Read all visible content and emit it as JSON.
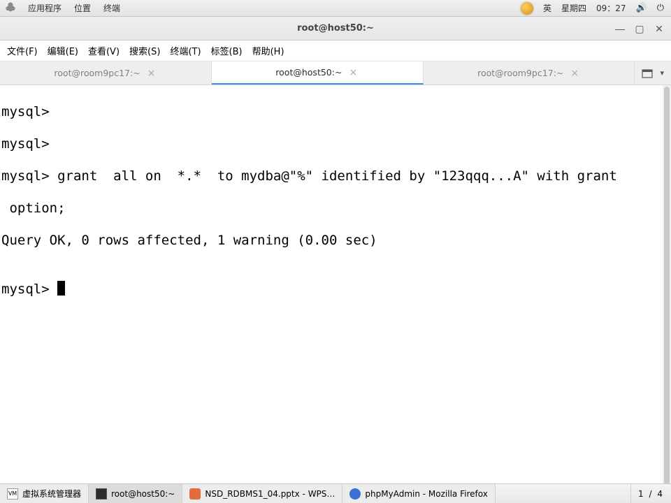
{
  "top_panel": {
    "apps": "应用程序",
    "places": "位置",
    "terminal": "终端",
    "ime_lang": "英",
    "day": "星期四",
    "time": "09：27"
  },
  "window": {
    "title": "root@host50:~",
    "btn_min": "—",
    "btn_max": "▢",
    "btn_close": "✕"
  },
  "menubar": {
    "file": "文件(F)",
    "edit": "编辑(E)",
    "view": "查看(V)",
    "search": "搜索(S)",
    "terminal": "终端(T)",
    "tabs": "标签(B)",
    "help": "帮助(H)"
  },
  "tabs": {
    "t0": {
      "label": "root@room9pc17:~",
      "close": "×"
    },
    "t1": {
      "label": "root@host50:~",
      "close": "×"
    },
    "t2": {
      "label": "root@room9pc17:~",
      "close": "×"
    }
  },
  "terminal": {
    "l0": "mysql>",
    "l1": "mysql>",
    "l2": "mysql> grant  all on  *.*  to mydba@\"%\" identified by \"123qqq...A\" with grant",
    "l3": " option;",
    "l4": "Query OK, 0 rows affected, 1 warning (0.00 sec)",
    "l5": "",
    "l6": "mysql> "
  },
  "taskbar": {
    "t0": "虚拟系统管理器",
    "t1": "root@host50:~",
    "t2": "NSD_RDBMS1_04.pptx - WPS…",
    "t3": "phpMyAdmin - Mozilla Firefox",
    "workspace": "1 / 4"
  }
}
